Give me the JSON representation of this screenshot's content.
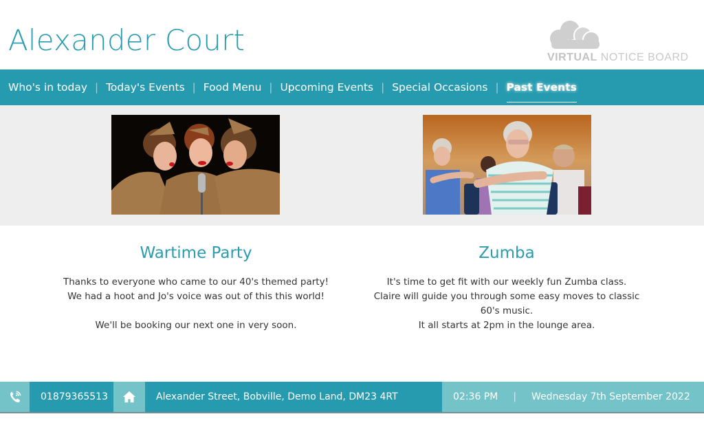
{
  "header": {
    "title": "Alexander Court",
    "logo": {
      "icon": "cloud-icon",
      "text_bold": "VIRTUAL",
      "text_regular": "NOTICE BOARD"
    }
  },
  "nav": {
    "items": [
      {
        "label": "Who's in today",
        "active": false
      },
      {
        "label": "Today's Events",
        "active": false
      },
      {
        "label": "Food Menu",
        "active": false
      },
      {
        "label": "Upcoming Events",
        "active": false
      },
      {
        "label": "Special Occasions",
        "active": false
      },
      {
        "label": "Past Events",
        "active": true
      }
    ],
    "separator": "|"
  },
  "events": [
    {
      "title": "Wartime Party",
      "image_alt": "Three singers in 1940s army uniforms around a vintage microphone",
      "description": "Thanks to everyone who came to our 40's themed party!\nWe had a hoot and Jo's voice was out of this this world!\n\nWe'll be booking our next one in very soon."
    },
    {
      "title": "Zumba",
      "image_alt": "Elderly residents doing seated exercise class",
      "description": "It's time to get fit with our weekly fun Zumba class.\nClaire will guide you through some easy moves to classic\n60's music.\nIt all starts at 2pm in the lounge area."
    }
  ],
  "footer": {
    "phone_icon": "phone-icon",
    "phone": "01879365513",
    "home_icon": "home-icon",
    "address": "Alexander Street, Bobville, Demo Land, DM23 4RT",
    "time": "02:36 PM",
    "separator": "|",
    "date": "Wednesday 7th September 2022"
  },
  "colors": {
    "brand": "#269bb0",
    "brand_light": "#74c3c9",
    "title_text": "#2a9cb0",
    "band_bg": "#eeeeee"
  }
}
